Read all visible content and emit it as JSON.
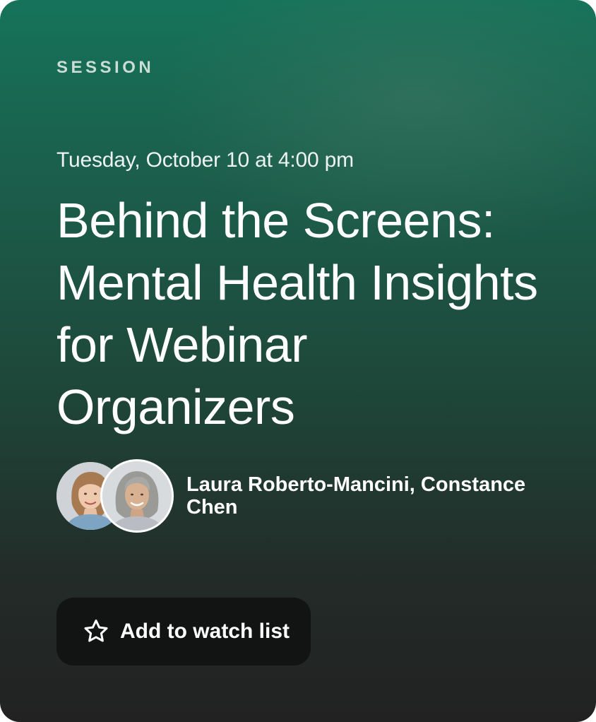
{
  "card": {
    "eyebrow": "SESSION",
    "datetime": "Tuesday, October 10 at 4:00 pm",
    "title": "Behind the Screens: Mental Health Insights for Webinar Organizers",
    "speakers": {
      "names": "Laura Roberto-Mancini, Constance Chen",
      "avatars": [
        {
          "icon": "avatar-woman-brown-hair"
        },
        {
          "icon": "avatar-woman-gray-hair"
        }
      ]
    },
    "watch_button": {
      "label": "Add to watch list",
      "icon": "star-outline-icon"
    }
  },
  "colors": {
    "gradient_top": "#16735a",
    "gradient_bottom": "#222222",
    "button_bg": "#121414",
    "text": "#ffffff"
  }
}
